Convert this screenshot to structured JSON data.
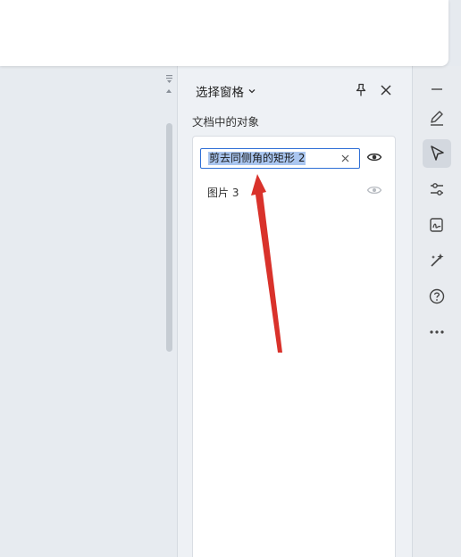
{
  "pane": {
    "title": "选择窗格",
    "section_label": "文档中的对象",
    "items": [
      {
        "label": "剪去同侧角的矩形 2",
        "editing": true
      },
      {
        "label": "图片 3",
        "editing": false
      }
    ]
  },
  "icons": {
    "title_dropdown": "chevron-down-icon",
    "pin": "pin-icon",
    "close": "close-icon",
    "clear": "clear-icon",
    "visibility": "eye-icon",
    "right_bar": [
      "collapse-icon",
      "pen-icon",
      "select-pointer-icon",
      "sliders-icon",
      "sign-icon",
      "magic-wand-icon",
      "help-icon",
      "more-icon"
    ]
  },
  "colors": {
    "accent": "#2f6fd6",
    "selection": "#aac6f0",
    "annotation_arrow": "#d9322b"
  }
}
